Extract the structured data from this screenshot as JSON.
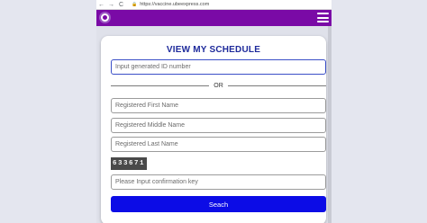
{
  "browser": {
    "url": "https://vaccine.ubeexpress.com",
    "back_icon": "←",
    "forward_icon": "→",
    "reload_icon": "C",
    "lock_icon": "lock-icon"
  },
  "app": {
    "brand_color": "#7a0aa6",
    "menu_icon": "hamburger-menu-icon"
  },
  "form": {
    "title": "VIEW MY SCHEDULE",
    "id_placeholder": "Input generated ID number",
    "divider_text": "OR",
    "first_name_placeholder": "Registered First Name",
    "middle_name_placeholder": "Registered Middle Name",
    "last_name_placeholder": "Registered Last Name",
    "captcha_code": "633671",
    "confirmation_placeholder": "Please Input confirmation key",
    "submit_label": "Seach",
    "submit_color": "#0c0ce6"
  }
}
